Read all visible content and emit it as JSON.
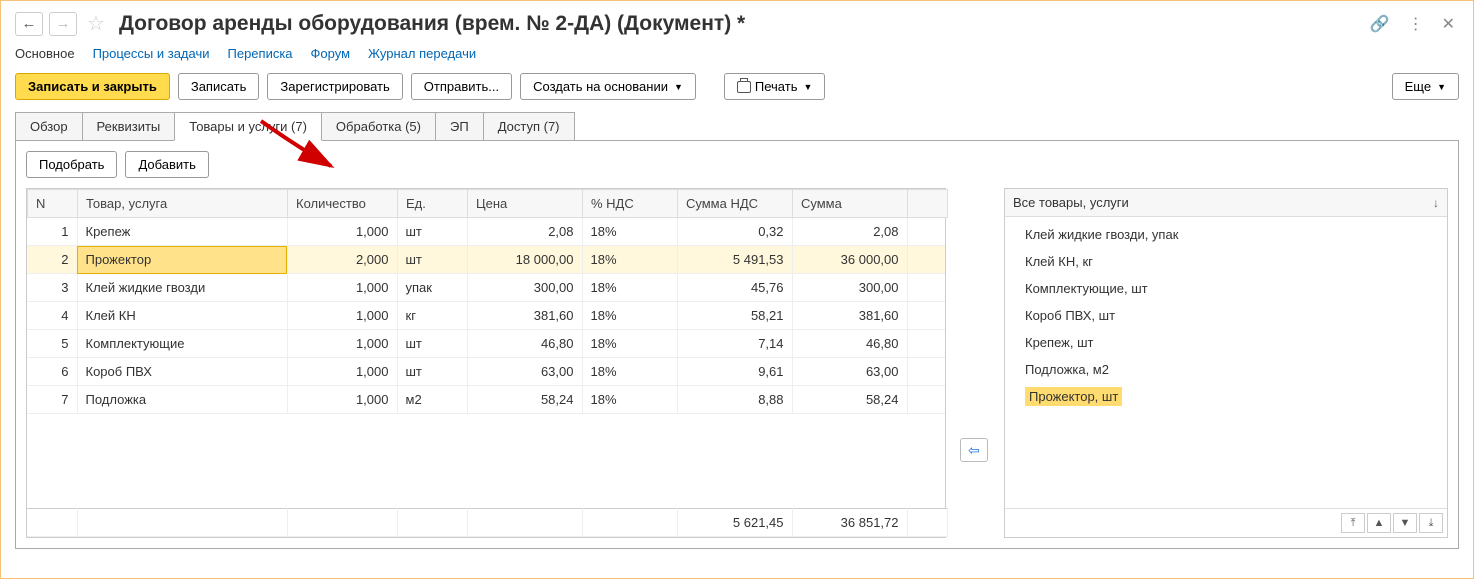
{
  "title": "Договор аренды оборудования (врем. № 2-ДА) (Документ) *",
  "nav_tabs": {
    "main": "Основное",
    "processes": "Процессы и задачи",
    "correspondence": "Переписка",
    "forum": "Форум",
    "transfer_log": "Журнал передачи"
  },
  "toolbar": {
    "save_close": "Записать и закрыть",
    "save": "Записать",
    "register": "Зарегистрировать",
    "send": "Отправить...",
    "create_based": "Создать на основании",
    "print": "Печать",
    "more": "Еще"
  },
  "content_tabs": {
    "overview": "Обзор",
    "requisites": "Реквизиты",
    "goods": "Товары и услуги (7)",
    "processing": "Обработка (5)",
    "ep": "ЭП",
    "access": "Доступ (7)"
  },
  "sub_toolbar": {
    "pick": "Подобрать",
    "add": "Добавить"
  },
  "columns": {
    "n": "N",
    "name": "Товар, услуга",
    "qty": "Количество",
    "unit": "Ед.",
    "price": "Цена",
    "vat_pct": "% НДС",
    "vat_sum": "Сумма НДС",
    "sum": "Сумма"
  },
  "rows": [
    {
      "n": "1",
      "name": "Крепеж",
      "qty": "1,000",
      "unit": "шт",
      "price": "2,08",
      "vat_pct": "18%",
      "vat_sum": "0,32",
      "sum": "2,08",
      "selected": false
    },
    {
      "n": "2",
      "name": "Прожектор",
      "qty": "2,000",
      "unit": "шт",
      "price": "18 000,00",
      "vat_pct": "18%",
      "vat_sum": "5 491,53",
      "sum": "36 000,00",
      "selected": true
    },
    {
      "n": "3",
      "name": "Клей жидкие гвозди",
      "qty": "1,000",
      "unit": "упак",
      "price": "300,00",
      "vat_pct": "18%",
      "vat_sum": "45,76",
      "sum": "300,00",
      "selected": false
    },
    {
      "n": "4",
      "name": "Клей КН",
      "qty": "1,000",
      "unit": "кг",
      "price": "381,60",
      "vat_pct": "18%",
      "vat_sum": "58,21",
      "sum": "381,60",
      "selected": false
    },
    {
      "n": "5",
      "name": "Комплектующие",
      "qty": "1,000",
      "unit": "шт",
      "price": "46,80",
      "vat_pct": "18%",
      "vat_sum": "7,14",
      "sum": "46,80",
      "selected": false
    },
    {
      "n": "6",
      "name": "Короб ПВХ",
      "qty": "1,000",
      "unit": "шт",
      "price": "63,00",
      "vat_pct": "18%",
      "vat_sum": "9,61",
      "sum": "63,00",
      "selected": false
    },
    {
      "n": "7",
      "name": "Подложка",
      "qty": "1,000",
      "unit": "м2",
      "price": "58,24",
      "vat_pct": "18%",
      "vat_sum": "8,88",
      "sum": "58,24",
      "selected": false
    }
  ],
  "totals": {
    "vat_sum": "5 621,45",
    "sum": "36 851,72"
  },
  "side": {
    "title": "Все товары, услуги",
    "items": [
      {
        "label": "Клей жидкие гвозди, упак",
        "highlight": false
      },
      {
        "label": "Клей КН, кг",
        "highlight": false
      },
      {
        "label": "Комплектующие, шт",
        "highlight": false
      },
      {
        "label": "Короб ПВХ, шт",
        "highlight": false
      },
      {
        "label": "Крепеж, шт",
        "highlight": false
      },
      {
        "label": "Подложка, м2",
        "highlight": false
      },
      {
        "label": "Прожектор, шт",
        "highlight": true
      }
    ]
  }
}
